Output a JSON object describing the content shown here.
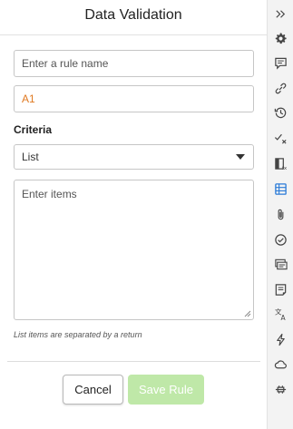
{
  "panel": {
    "title": "Data Validation",
    "rule_name_placeholder": "Enter a rule name",
    "range_value": "A1",
    "criteria_label": "Criteria",
    "criteria_selected": "List",
    "items_placeholder": "Enter items",
    "hint": "List items are separated by a return",
    "cancel_label": "Cancel",
    "save_label": "Save Rule"
  },
  "rail": {
    "icons": [
      "collapse-chevrons-icon",
      "gear-icon",
      "comment-icon",
      "link-icon",
      "history-icon",
      "checkmark-x-icon",
      "formula-icon",
      "data-validation-icon",
      "attachment-icon",
      "check-circle-icon",
      "cards-icon",
      "notes-icon",
      "translate-icon",
      "lightning-icon",
      "cloud-icon",
      "connector-icon"
    ],
    "active_icon": "data-validation-icon"
  },
  "colors": {
    "accent": "#2b7bd8",
    "range_text": "#e07a22",
    "save_button": "#bfe8a8"
  }
}
